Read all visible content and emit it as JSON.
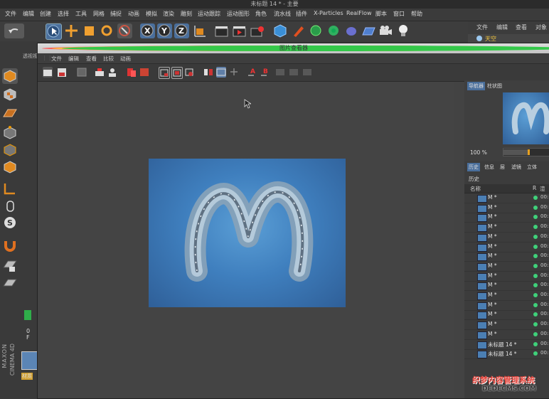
{
  "window_title": "未标题 14 * - 主要",
  "main_menu": [
    "文件",
    "编辑",
    "创建",
    "选择",
    "工具",
    "网格",
    "捕捉",
    "动画",
    "模拟",
    "渲染",
    "雕刻",
    "运动跟踪",
    "运动图形",
    "角色",
    "流水线",
    "插件",
    "X-Particles",
    "RealFlow",
    "脚本",
    "窗口",
    "帮助"
  ],
  "object_panel": {
    "tabs": [
      "文件",
      "编辑",
      "查看",
      "对象"
    ],
    "item": "天空"
  },
  "left_panel_label": "透视视",
  "viewer": {
    "title": "图片查看器",
    "menu": [
      "文件",
      "编辑",
      "查看",
      "比较",
      "动画"
    ],
    "nav_tabs": [
      "导航器",
      "柱状图"
    ],
    "zoom": "100 %",
    "history_tabs": [
      "历史",
      "信息",
      "层",
      "滤镜",
      "立体"
    ],
    "history_label": "历史",
    "col_name": "名称",
    "col_r": "R",
    "col_time": "渲",
    "rows": [
      "M *",
      "M *",
      "M *",
      "M *",
      "M *",
      "M *",
      "M *",
      "M *",
      "M *",
      "M *",
      "M *",
      "M *",
      "M *",
      "M *",
      "M *",
      "未标题 14 *",
      "未标题 14 *"
    ],
    "row_time": "00:"
  },
  "timeline": {
    "frame": "0 F"
  },
  "brand": {
    "line1": "MAXON",
    "line2": "CINEMA 4D"
  },
  "material_label": "材质",
  "watermark": {
    "line1": "织梦内容管理系统",
    "line2": "DEDECMS.COM"
  },
  "colors": {
    "accent_blue": "#3d6ea8",
    "green_dot": "#3fd17a"
  }
}
